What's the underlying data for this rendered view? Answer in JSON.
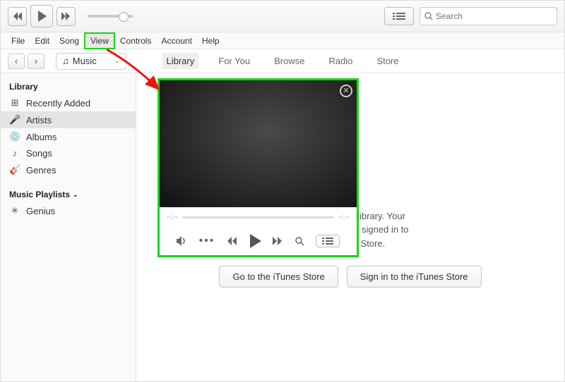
{
  "window_controls": {
    "min": "—",
    "max": "▢",
    "close": "✕"
  },
  "topbar": {
    "apple": "",
    "search_placeholder": "Search"
  },
  "menubar": [
    "File",
    "Edit",
    "Song",
    "View",
    "Controls",
    "Account",
    "Help"
  ],
  "menubar_highlighted_index": 3,
  "subhead": {
    "music_label": "Music",
    "tabs": [
      "Library",
      "For You",
      "Browse",
      "Radio",
      "Store"
    ],
    "active_tab_index": 0
  },
  "sidebar": {
    "heading1": "Library",
    "items": [
      {
        "icon": "⊞",
        "label": "Recently Added"
      },
      {
        "icon": "🎤",
        "label": "Artists"
      },
      {
        "icon": "💿",
        "label": "Albums"
      },
      {
        "icon": "♪",
        "label": "Songs"
      },
      {
        "icon": "🎸",
        "label": "Genres"
      }
    ],
    "selected_index": 1,
    "heading2": "Music Playlists",
    "playlists": [
      {
        "icon": "✳",
        "label": "Genius"
      }
    ]
  },
  "main": {
    "helptext_tail": "r in your music library. Your\n whenever you're signed in to\nthe iTunes Store.",
    "btn_store": "Go to the iTunes Store",
    "btn_signin": "Sign in to the iTunes Store"
  },
  "miniplayer": {
    "time_l": "--:--",
    "time_r": "--:--"
  }
}
